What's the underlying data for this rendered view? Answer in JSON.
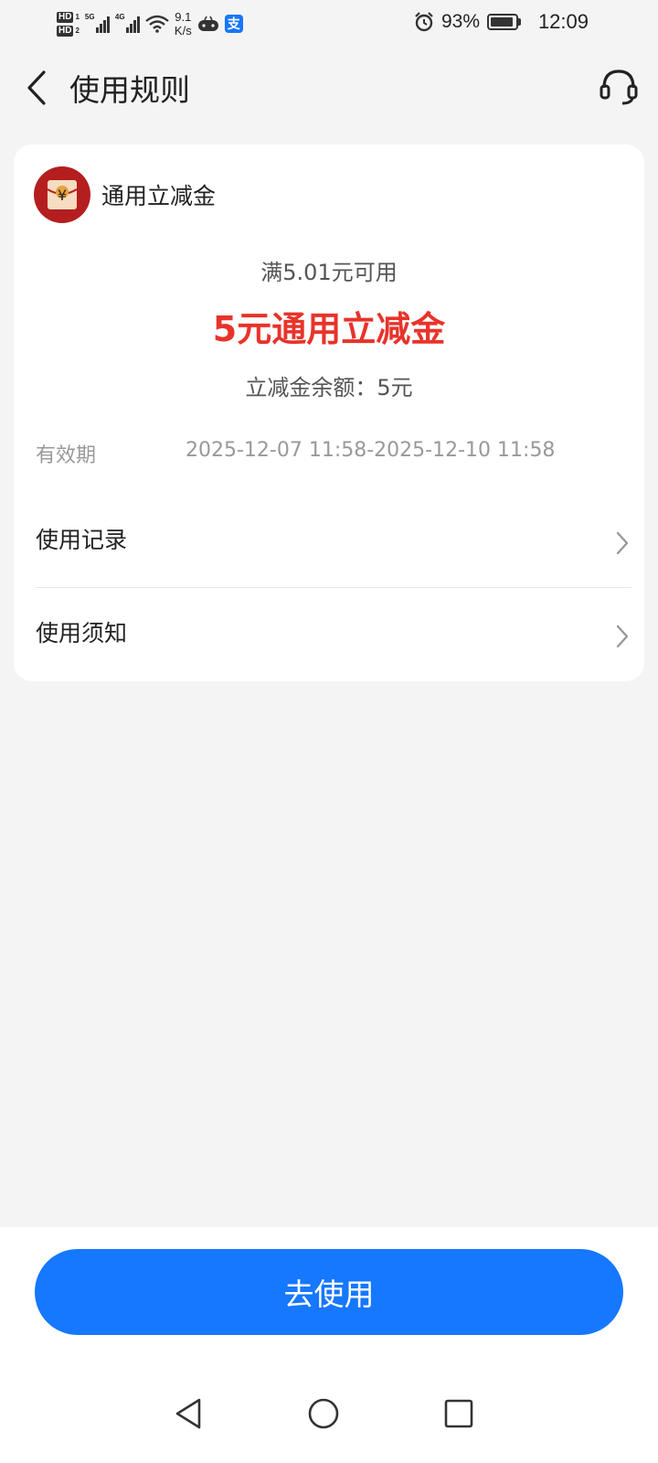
{
  "status_bar": {
    "hd1": "HD",
    "hd1_sub": "1",
    "hd2": "HD",
    "hd2_sub": "2",
    "net1": "5G",
    "net2": "4G",
    "speed_value": "9.1",
    "speed_unit": "K/s",
    "alipay_glyph": "支",
    "battery_percent": "93%",
    "battery_level": 0.93,
    "time": "12:09"
  },
  "header": {
    "title": "使用规则"
  },
  "coupon": {
    "name": "通用立减金",
    "logo_glyph": "¥",
    "min_spend": "满5.01元可用",
    "title": "5元通用立减金",
    "balance": "立减金余额：5元",
    "validity_label": "有效期",
    "validity_value": "2025-12-07 11:58-2025-12-10 11:58"
  },
  "rows": {
    "usage_record": "使用记录",
    "usage_notice": "使用须知"
  },
  "actions": {
    "use_button": "去使用"
  },
  "colors": {
    "accent": "#1677ff",
    "coupon_red": "#e8332a",
    "logo_red": "#b51e1e"
  }
}
